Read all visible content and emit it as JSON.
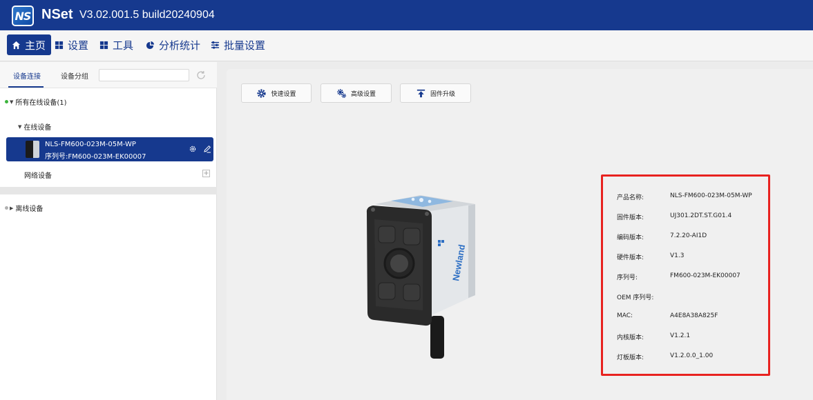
{
  "app": {
    "logo_text": "NS",
    "name": "NSet",
    "version": "V3.02.001.5 build20240904"
  },
  "menu": [
    {
      "label": "主页",
      "icon": "home-icon"
    },
    {
      "label": "设置",
      "icon": "grid-icon"
    },
    {
      "label": "工具",
      "icon": "grid-icon"
    },
    {
      "label": "分析统计",
      "icon": "pie-chart-icon"
    },
    {
      "label": "批量设置",
      "icon": "batch-settings-icon"
    }
  ],
  "left": {
    "tabs": [
      "设备连接",
      "设备分组"
    ],
    "search_value": "",
    "all_online": "所有在线设备(1)",
    "online_group": "在线设备",
    "device": {
      "name": "NLS-FM600-023M-05M-WP",
      "serial": "序列号:FM600-023M-EK00007"
    },
    "network_group": "网络设备",
    "offline_group": "离线设备",
    "colors": {
      "online": "#3cb43c",
      "offline": "#b0b0b0",
      "accent": "#16398e"
    }
  },
  "actions": [
    {
      "label": "快速设置",
      "icon": "gear-icon"
    },
    {
      "label": "高级设置",
      "icon": "gears-icon"
    },
    {
      "label": "固件升级",
      "icon": "upload-icon"
    }
  ],
  "info": {
    "rows": [
      {
        "label": "产品名称:",
        "value": "NLS-FM600-023M-05M-WP"
      },
      {
        "label": "固件版本:",
        "value": "UJ301.2DT.ST.G01.4"
      },
      {
        "label": "编码版本:",
        "value": "7.2.20-AI1D"
      },
      {
        "label": "硬件版本:",
        "value": "V1.3"
      },
      {
        "label": "序列号:",
        "value": "FM600-023M-EK00007"
      },
      {
        "label": "OEM 序列号:",
        "value": ""
      },
      {
        "label": "MAC:",
        "value": "A4E8A38A825F"
      },
      {
        "label": "内核版本:",
        "value": "V1.2.1"
      },
      {
        "label": "灯板版本:",
        "value": "V1.2.0.0_1.00"
      }
    ],
    "highlight_color": "#e8221f"
  },
  "camera": {
    "brand": "Newland"
  }
}
